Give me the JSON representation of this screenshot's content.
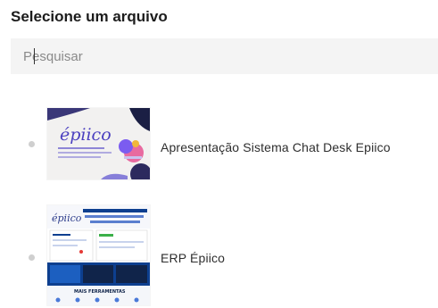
{
  "header": {
    "title": "Selecione um arquivo"
  },
  "search": {
    "placeholder": "Pesquisar",
    "value": ""
  },
  "files": [
    {
      "name": "Apresentação Sistema Chat Desk Epiico",
      "thumbnail": {
        "logo": "épiico",
        "icon": "chat-bubble-icon"
      }
    },
    {
      "name": "ERP Épiico",
      "thumbnail": {
        "logo": "épiico",
        "footer_label": "MAIS FERRAMENTAS"
      }
    }
  ],
  "colors": {
    "accent": "#4a3fbf",
    "chat_pink": "#e86aa0",
    "chat_purple": "#7b5cf0",
    "doc_blue": "#0d3f8f",
    "doc_dark": "#10244a"
  }
}
